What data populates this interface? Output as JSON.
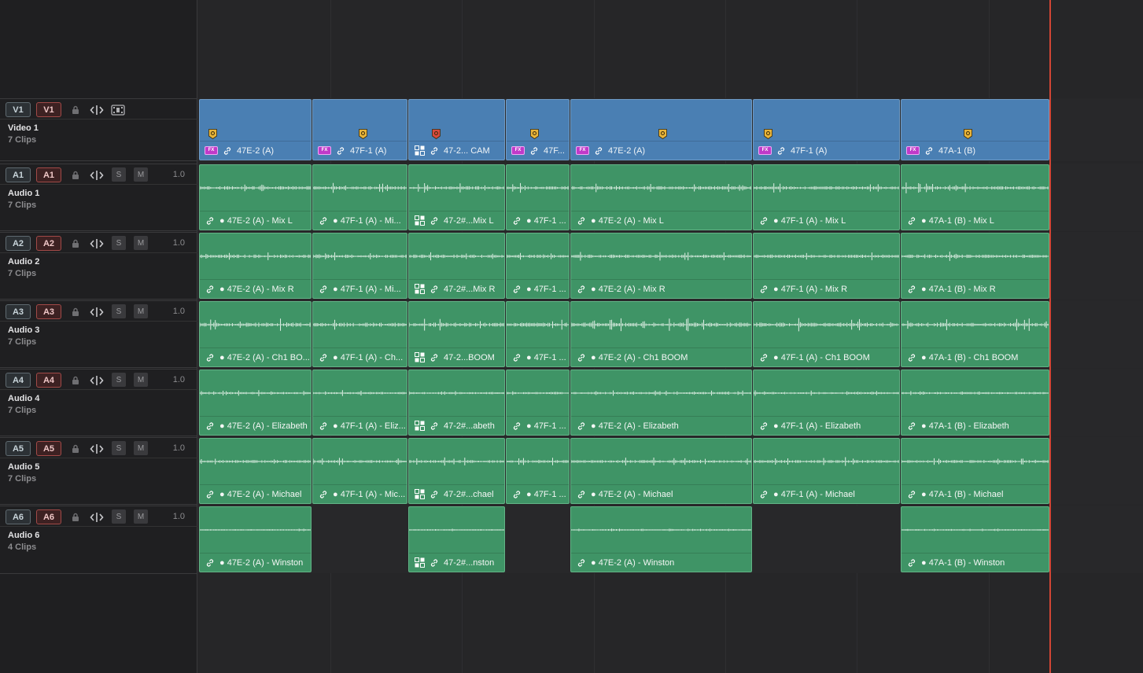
{
  "tracks": [
    {
      "dest": "V1",
      "src": "V1",
      "name": "Video 1",
      "count": "7 Clips",
      "type": "video",
      "volume": "",
      "solo": "",
      "mute": ""
    },
    {
      "dest": "A1",
      "src": "A1",
      "name": "Audio 1",
      "count": "7 Clips",
      "type": "audio",
      "volume": "1.0",
      "solo": "S",
      "mute": "M"
    },
    {
      "dest": "A2",
      "src": "A2",
      "name": "Audio 2",
      "count": "7 Clips",
      "type": "audio",
      "volume": "1.0",
      "solo": "S",
      "mute": "M"
    },
    {
      "dest": "A3",
      "src": "A3",
      "name": "Audio 3",
      "count": "7 Clips",
      "type": "audio",
      "volume": "1.0",
      "solo": "S",
      "mute": "M"
    },
    {
      "dest": "A4",
      "src": "A4",
      "name": "Audio 4",
      "count": "7 Clips",
      "type": "audio",
      "volume": "1.0",
      "solo": "S",
      "mute": "M"
    },
    {
      "dest": "A5",
      "src": "A5",
      "name": "Audio 5",
      "count": "7 Clips",
      "type": "audio",
      "volume": "1.0",
      "solo": "S",
      "mute": "M"
    },
    {
      "dest": "A6",
      "src": "A6",
      "name": "Audio 6",
      "count": "4 Clips",
      "type": "audio",
      "volume": "1.0",
      "solo": "S",
      "mute": "M"
    }
  ],
  "clips": [
    [
      {
        "label": "47E-2 (A)",
        "icon": "fx",
        "marker": "yellow"
      },
      {
        "label": "47F-1 (A)",
        "icon": "fx",
        "marker": "yellow"
      },
      {
        "label": "47-2... CAM",
        "icon": "multicam",
        "marker": "red"
      },
      {
        "label": "47F...",
        "icon": "fx",
        "marker": "yellow"
      },
      {
        "label": "47E-2 (A)",
        "icon": "fx",
        "marker": "yellow"
      },
      {
        "label": "47F-1 (A)",
        "icon": "fx",
        "marker": "yellow"
      },
      {
        "label": "47A-1 (B)",
        "icon": "fx",
        "marker": "yellow"
      }
    ],
    [
      {
        "label": "● 47E-2 (A) - Mix L"
      },
      {
        "label": "● 47F-1 (A) - Mi..."
      },
      {
        "label": "47-2#...Mix L",
        "icon": "multicam"
      },
      {
        "label": "● 47F-1 ..."
      },
      {
        "label": "● 47E-2 (A) - Mix L"
      },
      {
        "label": "● 47F-1 (A) - Mix L"
      },
      {
        "label": "● 47A-1 (B) - Mix L"
      }
    ],
    [
      {
        "label": "● 47E-2 (A) - Mix R"
      },
      {
        "label": "● 47F-1 (A) - Mi..."
      },
      {
        "label": "47-2#...Mix R",
        "icon": "multicam"
      },
      {
        "label": "● 47F-1 ..."
      },
      {
        "label": "● 47E-2 (A) - Mix R"
      },
      {
        "label": "● 47F-1 (A) - Mix R"
      },
      {
        "label": "● 47A-1 (B) - Mix R"
      }
    ],
    [
      {
        "label": "● 47E-2 (A) - Ch1 BO..."
      },
      {
        "label": "● 47F-1 (A) - Ch..."
      },
      {
        "label": "47-2...BOOM",
        "icon": "multicam"
      },
      {
        "label": "● 47F-1 ..."
      },
      {
        "label": "● 47E-2 (A) - Ch1 BOOM"
      },
      {
        "label": "● 47F-1 (A) - Ch1 BOOM"
      },
      {
        "label": "● 47A-1 (B) - Ch1 BOOM"
      }
    ],
    [
      {
        "label": "● 47E-2 (A) - Elizabeth"
      },
      {
        "label": "● 47F-1 (A) - Eliz..."
      },
      {
        "label": "47-2#...abeth",
        "icon": "multicam"
      },
      {
        "label": "● 47F-1 ..."
      },
      {
        "label": "● 47E-2 (A) - Elizabeth"
      },
      {
        "label": "● 47F-1 (A) - Elizabeth"
      },
      {
        "label": "● 47A-1 (B) - Elizabeth"
      }
    ],
    [
      {
        "label": "● 47E-2 (A) - Michael"
      },
      {
        "label": "● 47F-1 (A) - Mic..."
      },
      {
        "label": "47-2#...chael",
        "icon": "multicam"
      },
      {
        "label": "● 47F-1 ..."
      },
      {
        "label": "● 47E-2 (A) - Michael"
      },
      {
        "label": "● 47F-1 (A) - Michael"
      },
      {
        "label": "● 47A-1 (B) - Michael"
      }
    ],
    [
      {
        "label": "● 47E-2 (A) - Winston",
        "slot": 0
      },
      {
        "label": "47-2#...nston",
        "icon": "multicam",
        "slot": 2
      },
      {
        "label": "● 47E-2 (A) - Winston",
        "slot": 4
      },
      {
        "label": "● 47A-1 (B) - Winston",
        "slot": 6
      }
    ]
  ],
  "colors": {
    "video_clip": "#4a7fb3",
    "audio_clip": "#3f9466",
    "playhead": "#d14535",
    "marker_yellow": "#e8b53a",
    "marker_red": "#d94a3e",
    "fx_badge": "#c03ac9"
  }
}
